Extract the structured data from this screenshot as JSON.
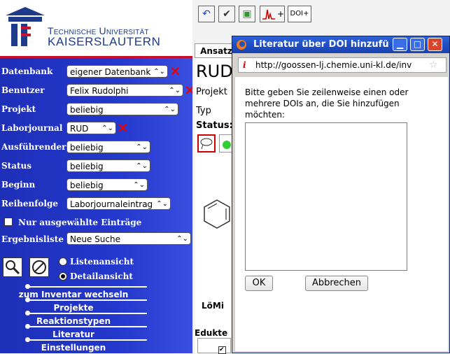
{
  "university": {
    "line1": "Technische Universität",
    "line2": "Kaiserslautern"
  },
  "filters": [
    {
      "label": "Datenbank",
      "value": "eigener Datenbank",
      "has_x": true
    },
    {
      "label": "Benutzer",
      "value": "Felix Rudolphi",
      "has_x": true
    },
    {
      "label": "Projekt",
      "value": "beliebig",
      "has_x": false
    },
    {
      "label": "Laborjournal",
      "value": "RUD",
      "has_x": true
    },
    {
      "label": "Ausführender",
      "value": "beliebig",
      "has_x": false
    },
    {
      "label": "Status",
      "value": "beliebig",
      "has_x": false
    },
    {
      "label": "Beginn",
      "value": "beliebig",
      "has_x": false
    },
    {
      "label": "Reihenfolge",
      "value": "Laborjournaleintrag",
      "has_x": false
    }
  ],
  "only_selected_label": "Nur ausgewählte Einträge",
  "result_list": {
    "label": "Ergebnisliste",
    "value": "Neue Suche"
  },
  "view_options": {
    "list": "Listenansicht",
    "detail": "Detailansicht"
  },
  "nav": [
    "zum Inventar wechseln",
    "Projekte",
    "Reaktionstypen",
    "Literatur",
    "Einstellungen"
  ],
  "toolbar": {
    "doi_label": "DOI+",
    "plus_label": "+"
  },
  "main": {
    "tab": "Ansatz",
    "title": "RUD",
    "projekt": "Projekt",
    "typ": "Typ",
    "status": "Status:",
    "loemi": "LöMi",
    "edukte": "Edukte"
  },
  "dialog": {
    "title": "Literatur über DOI hinzufü",
    "url": "http://goossen-lj.chemie.uni-kl.de/inv",
    "instructions": "Bitte geben Sie zeilenweise einen oder mehrere DOIs an, die Sie hinzufügen möchten:",
    "textarea_value": "",
    "ok_label": "OK",
    "cancel_label": "Abbrechen"
  },
  "colors": {
    "sidebar_blue": "#2338cc",
    "accent_red": "#c8102e",
    "titlebar_blue": "#1f4fc5"
  }
}
